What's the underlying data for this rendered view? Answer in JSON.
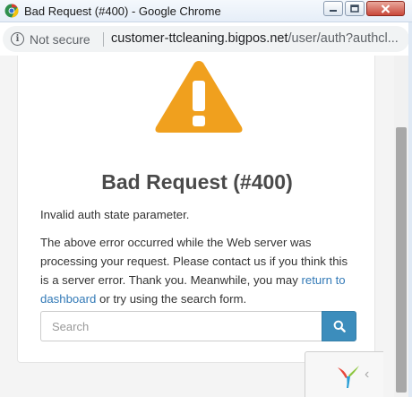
{
  "window": {
    "title": "Bad Request (#400) - Google Chrome",
    "app_icon": "chrome-icon"
  },
  "addressbar": {
    "security_label": "Not secure",
    "url_host": "customer-ttcleaning.bigpos.net",
    "url_path": "/user/auth?authcl..."
  },
  "page": {
    "icon": "warning-triangle-icon",
    "title": "Bad Request (#400)",
    "message": "Invalid auth state parameter.",
    "body_before_link": "The above error occurred while the Web server was processing your request. Please contact us if you think this is a server error. Thank you. Meanwhile, you may ",
    "link_text": "return to dashboard",
    "body_after_link": " or try using the search form.",
    "search_placeholder": "Search",
    "search_icon": "search-icon"
  },
  "colors": {
    "warning": "#f0a01e",
    "primary": "#3c8dbc",
    "link": "#337ab7"
  }
}
